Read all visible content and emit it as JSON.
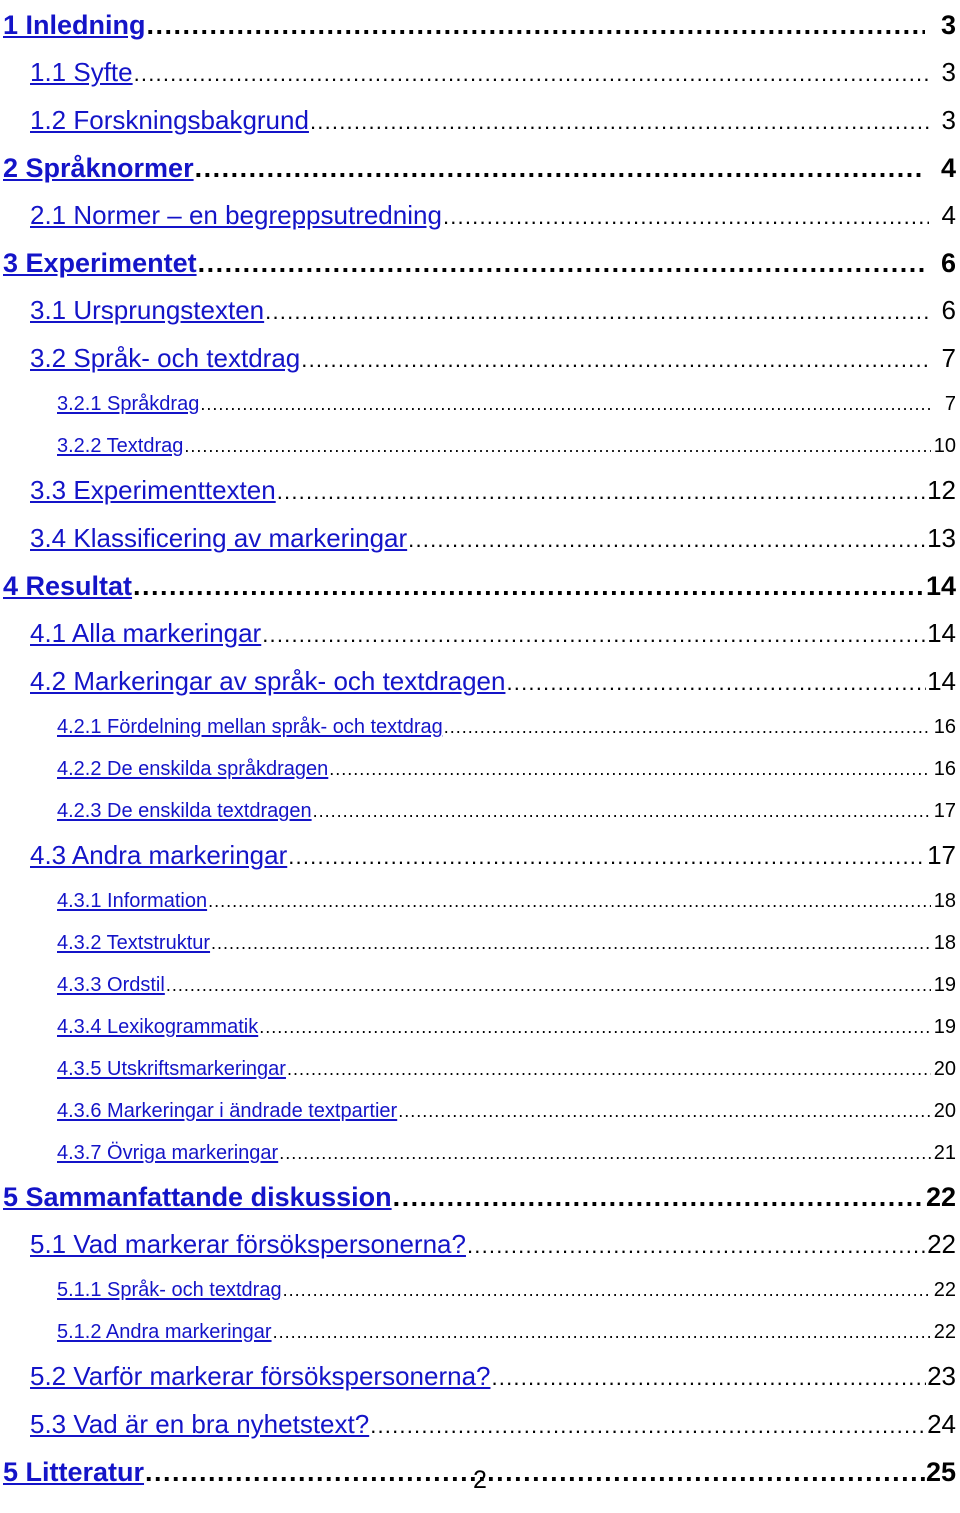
{
  "document": {
    "type": "table-of-contents",
    "language": "sv",
    "link_color": "#1414c8",
    "page_number_color": "#000000",
    "background_color": "#ffffff",
    "footer_page_number": "2"
  },
  "toc": {
    "entries": [
      {
        "level": 1,
        "title": "1 Inledning",
        "page": "3"
      },
      {
        "level": 2,
        "title": "1.1 Syfte",
        "page": "3"
      },
      {
        "level": 2,
        "title": "1.2 Forskningsbakgrund",
        "page": "3"
      },
      {
        "level": 1,
        "title": "2 Språknormer",
        "page": "4"
      },
      {
        "level": 2,
        "title": "2.1 Normer – en begreppsutredning",
        "page": "4"
      },
      {
        "level": 1,
        "title": "3 Experimentet",
        "page": "6"
      },
      {
        "level": 2,
        "title": "3.1 Ursprungstexten",
        "page": "6"
      },
      {
        "level": 2,
        "title": "3.2 Språk- och textdrag",
        "page": "7"
      },
      {
        "level": 3,
        "title": "3.2.1 Språkdrag",
        "page": "7"
      },
      {
        "level": 3,
        "title": "3.2.2 Textdrag",
        "page": "10"
      },
      {
        "level": 2,
        "title": "3.3 Experimenttexten",
        "page": "12"
      },
      {
        "level": 2,
        "title": "3.4 Klassificering av markeringar",
        "page": "13"
      },
      {
        "level": 1,
        "title": "4 Resultat",
        "page": "14"
      },
      {
        "level": 2,
        "title": "4.1 Alla markeringar",
        "page": "14"
      },
      {
        "level": 2,
        "title": "4.2 Markeringar av språk- och textdragen",
        "page": "14"
      },
      {
        "level": 3,
        "title": "4.2.1 Fördelning mellan språk- och textdrag",
        "page": "16"
      },
      {
        "level": 3,
        "title": "4.2.2 De enskilda språkdragen",
        "page": "16"
      },
      {
        "level": 3,
        "title": "4.2.3 De enskilda textdragen",
        "page": "17"
      },
      {
        "level": 2,
        "title": "4.3 Andra markeringar",
        "page": "17"
      },
      {
        "level": 3,
        "title": "4.3.1 Information",
        "page": "18"
      },
      {
        "level": 3,
        "title": "4.3.2 Textstruktur",
        "page": "18"
      },
      {
        "level": 3,
        "title": "4.3.3 Ordstil",
        "page": "19"
      },
      {
        "level": 3,
        "title": "4.3.4 Lexikogrammatik",
        "page": "19"
      },
      {
        "level": 3,
        "title": "4.3.5 Utskriftsmarkeringar",
        "page": "20"
      },
      {
        "level": 3,
        "title": "4.3.6 Markeringar i ändrade textpartier",
        "page": "20"
      },
      {
        "level": 3,
        "title": "4.3.7 Övriga markeringar",
        "page": "21"
      },
      {
        "level": 1,
        "title": "5 Sammanfattande diskussion",
        "page": "22"
      },
      {
        "level": 2,
        "title": "5.1 Vad markerar försökspersonerna?",
        "page": "22"
      },
      {
        "level": 3,
        "title": "5.1.1 Språk- och textdrag",
        "page": "22"
      },
      {
        "level": 3,
        "title": "5.1.2 Andra markeringar",
        "page": "22"
      },
      {
        "level": 2,
        "title": "5.2 Varför markerar försökspersonerna?",
        "page": "23"
      },
      {
        "level": 2,
        "title": "5.3 Vad är en bra nyhetstext?",
        "page": "24"
      },
      {
        "level": 1,
        "title": "5 Litteratur",
        "page": "25"
      }
    ]
  }
}
